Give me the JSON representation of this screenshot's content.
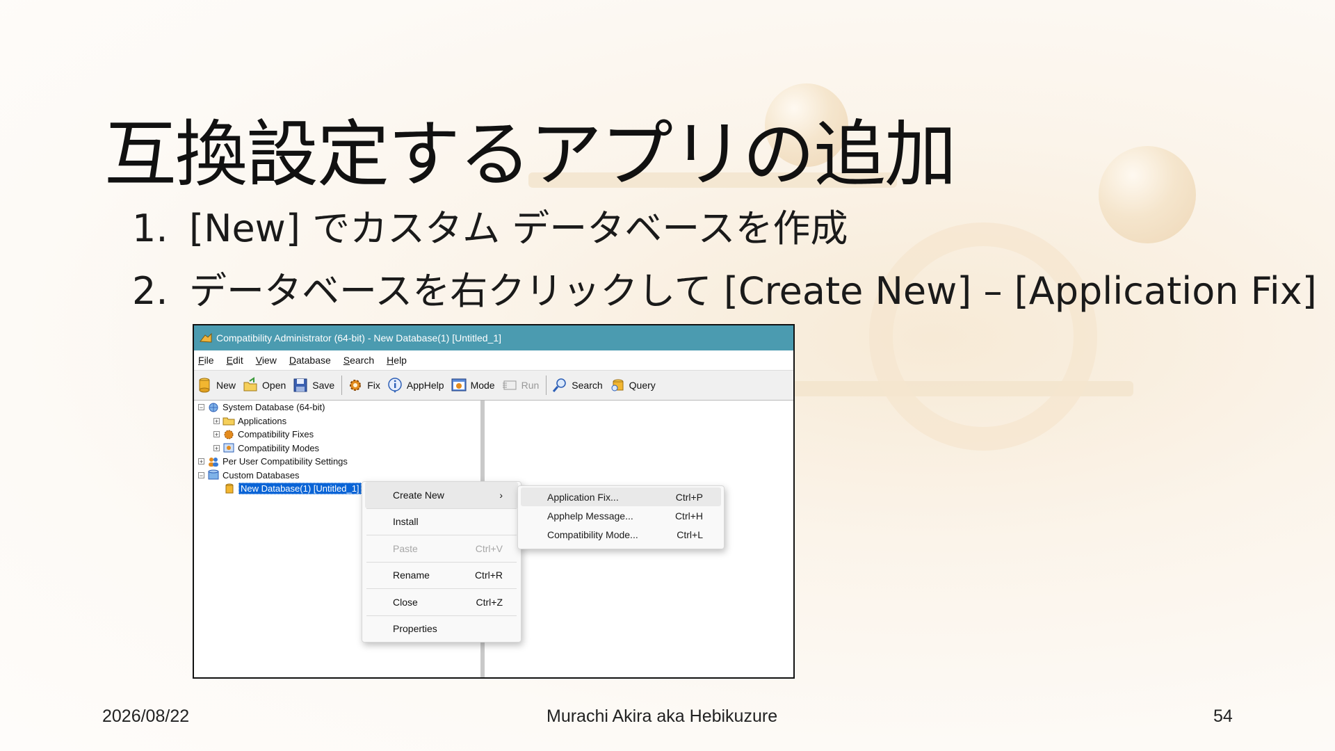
{
  "slide": {
    "title": "互換設定するアプリの追加",
    "steps": [
      {
        "num": "1.",
        "text": "[New]  でカスタム データベースを作成"
      },
      {
        "num": "2.",
        "text": "データベースを右クリックして [Create New] – [Application Fix]"
      }
    ],
    "footer": {
      "date": "2026/08/22",
      "author": "Murachi Akira aka Hebikuzure",
      "page": "54"
    }
  },
  "window": {
    "title": "Compatibility Administrator (64-bit) - New Database(1) [Untitled_1]",
    "menu": [
      "File",
      "Edit",
      "View",
      "Database",
      "Search",
      "Help"
    ],
    "toolbar": [
      {
        "label": "New",
        "icon": "database-icon"
      },
      {
        "label": "Open",
        "icon": "open-folder-icon"
      },
      {
        "label": "Save",
        "icon": "save-icon"
      },
      {
        "label": "Fix",
        "icon": "fix-gear-icon"
      },
      {
        "label": "AppHelp",
        "icon": "info-icon"
      },
      {
        "label": "Mode",
        "icon": "mode-icon"
      },
      {
        "label": "Run",
        "icon": "run-icon",
        "disabled": true
      },
      {
        "label": "Search",
        "icon": "search-icon"
      },
      {
        "label": "Query",
        "icon": "query-icon"
      }
    ],
    "tree": [
      {
        "label": "System Database (64-bit)",
        "expander": "−",
        "icon": "globe-database-icon"
      },
      {
        "label": "Applications",
        "expander": "+",
        "icon": "applications-icon"
      },
      {
        "label": "Compatibility Fixes",
        "expander": "+",
        "icon": "fixes-icon"
      },
      {
        "label": "Compatibility Modes",
        "expander": "+",
        "icon": "modes-icon"
      },
      {
        "label": "Per User Compatibility Settings",
        "expander": "+",
        "icon": "users-icon"
      },
      {
        "label": "Custom Databases",
        "expander": "−",
        "icon": "custom-databases-icon"
      },
      {
        "label": "New Database(1) [Untitled_1]",
        "icon": "database-icon",
        "selected": true
      }
    ],
    "context_menu": [
      {
        "label": "Create New",
        "shortcut": "",
        "submenu": true
      },
      {
        "label": "Install",
        "shortcut": ""
      },
      {
        "label": "Paste",
        "shortcut": "Ctrl+V",
        "disabled": true
      },
      {
        "label": "Rename",
        "shortcut": "Ctrl+R"
      },
      {
        "label": "Close",
        "shortcut": "Ctrl+Z"
      },
      {
        "label": "Properties",
        "shortcut": ""
      }
    ],
    "submenu": [
      {
        "label": "Application Fix...",
        "shortcut": "Ctrl+P"
      },
      {
        "label": "Apphelp Message...",
        "shortcut": "Ctrl+H"
      },
      {
        "label": "Compatibility Mode...",
        "shortcut": "Ctrl+L"
      }
    ]
  }
}
